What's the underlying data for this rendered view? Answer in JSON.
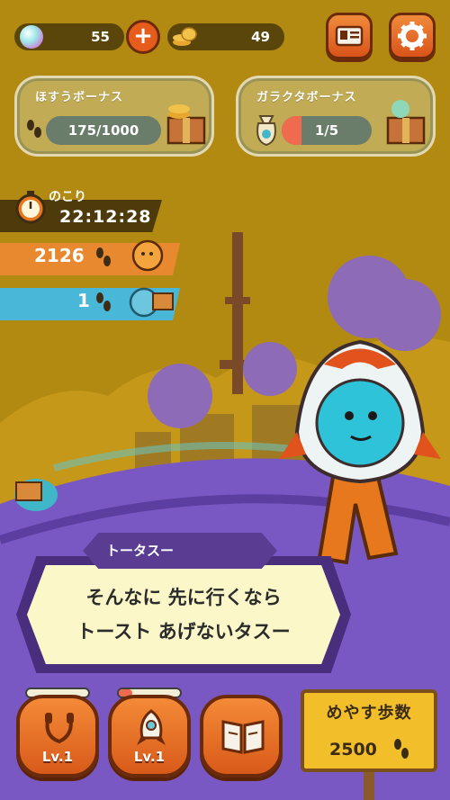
{
  "currencies": {
    "gems": "55",
    "coins": "49"
  },
  "bonuses": {
    "steps_bonus": {
      "title": "ほすうボーナス",
      "progress": "175/1000",
      "fraction": 0.175
    },
    "junk_bonus": {
      "title": "ガラクタボーナス",
      "progress": "1/5",
      "fraction": 0.2
    }
  },
  "timer": {
    "label": "のこり",
    "time": "22:12:28"
  },
  "race": {
    "player_steps": "2126",
    "rival_steps": "1"
  },
  "dialogue": {
    "speaker": "トータスー",
    "line1": "そんなに 先に行くなら",
    "line2": "トースト あげないタスー"
  },
  "items": [
    {
      "level": "Lv.1",
      "gauge": 0.0
    },
    {
      "level": "Lv.1",
      "gauge": 0.22
    }
  ],
  "signboard": {
    "title": "めやす歩数",
    "steps": "2500"
  },
  "colors": {
    "accent_orange": "#e65c1c",
    "dialog_purple": "#4a2e7e",
    "sign_yellow": "#f2be2a",
    "rival_blue": "#49b7d8"
  }
}
